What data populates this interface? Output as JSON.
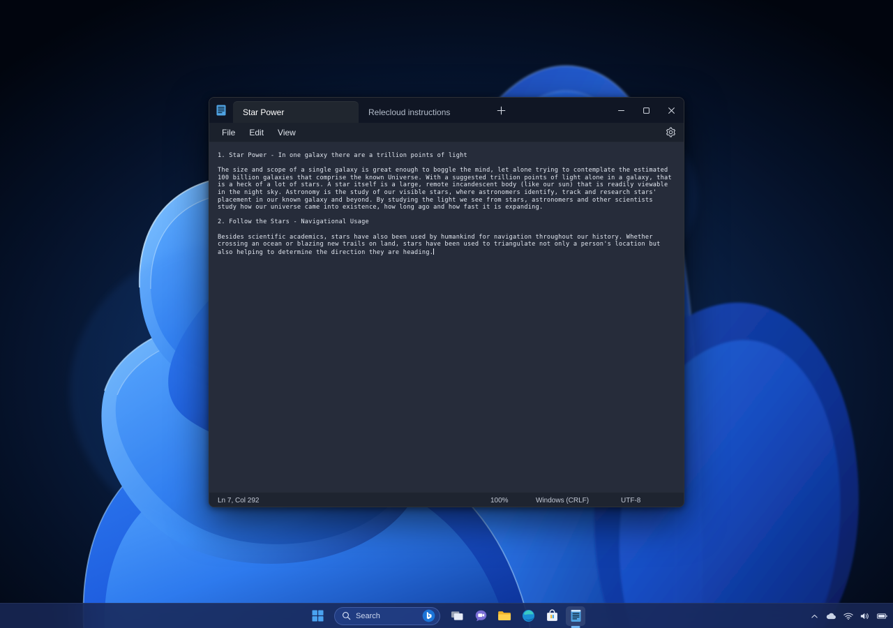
{
  "window": {
    "app_icon": "notepad-document-icon",
    "tabs": [
      {
        "label": "Star Power",
        "active": true
      },
      {
        "label": "Relecloud instructions",
        "active": false
      }
    ],
    "new_tab_icon": "plus-icon",
    "controls": {
      "minimize_icon": "minimize-icon",
      "maximize_icon": "maximize-icon",
      "close_icon": "close-icon"
    },
    "menu": [
      {
        "label": "File"
      },
      {
        "label": "Edit"
      },
      {
        "label": "View"
      }
    ],
    "settings_icon": "gear-icon",
    "editor": {
      "content": "1. Star Power - In one galaxy there are a trillion points of light\n\nThe size and scope of a single galaxy is great enough to boggle the mind, let alone trying to contemplate the estimated 100 billion galaxies that comprise the known Universe. With a suggested trillion points of light alone in a galaxy, that is a heck of a lot of stars. A star itself is a large, remote incandescent body (like our sun) that is readily viewable in the night sky. Astronomy is the study of our visible stars, where astronomers identify, track and research stars' placement in our known galaxy and beyond. By studying the light we see from stars, astronomers and other scientists study how our universe came into existence, how long ago and how fast it is expanding.\n\n2. Follow the Stars - Navigational Usage\n\nBesides scientific academics, stars have also been used by humankind for navigation throughout our history. Whether crossing an ocean or blazing new trails on land, stars have been used to triangulate not only a person's location but also helping to determine the direction they are heading."
    },
    "statusbar": {
      "position": "Ln 7, Col 292",
      "zoom": "100%",
      "line_ending": "Windows (CRLF)",
      "encoding": "UTF-8"
    }
  },
  "taskbar": {
    "start_icon": "windows-start-icon",
    "search": {
      "icon": "search-icon",
      "placeholder": "Search",
      "copilot_icon": "copilot-bing-icon"
    },
    "items": [
      {
        "name": "task-view",
        "icon": "task-view-icon",
        "active": false
      },
      {
        "name": "chat-teams",
        "icon": "chat-video-icon",
        "active": false
      },
      {
        "name": "file-explorer",
        "icon": "folder-icon",
        "active": false
      },
      {
        "name": "microsoft-edge",
        "icon": "edge-icon",
        "active": false
      },
      {
        "name": "microsoft-store",
        "icon": "store-bag-icon",
        "active": false
      },
      {
        "name": "notepad",
        "icon": "notepad-document-icon",
        "active": true
      }
    ],
    "tray": [
      {
        "name": "show-hidden-icons",
        "icon": "chevron-up-icon"
      },
      {
        "name": "onedrive",
        "icon": "cloud-icon"
      },
      {
        "name": "network",
        "icon": "wifi-icon"
      },
      {
        "name": "volume",
        "icon": "speaker-icon"
      },
      {
        "name": "battery",
        "icon": "battery-icon"
      }
    ]
  },
  "colors": {
    "accent": "#6fb3f0",
    "window_bg": "#202020",
    "titlebar_bg": "#101624",
    "editor_bg": "#262c3a",
    "statusbar_bg": "#1e2430",
    "taskbar_bg": "#182856",
    "text": "#e2e7f0"
  }
}
